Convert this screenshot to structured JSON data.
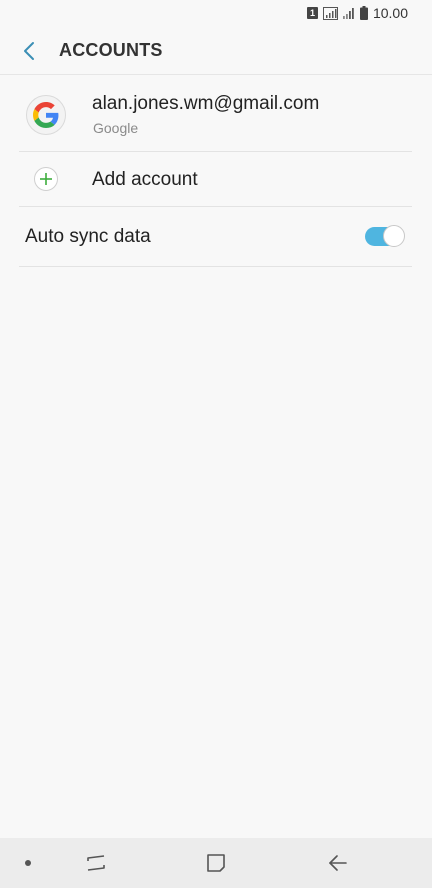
{
  "status_bar": {
    "sim_label": "1",
    "time": "10.00"
  },
  "header": {
    "title": "ACCOUNTS",
    "back_icon": "chevron-left-icon"
  },
  "accounts": [
    {
      "email": "alan.jones.wm@gmail.com",
      "provider": "Google",
      "icon": "google-logo-icon"
    }
  ],
  "add_account": {
    "label": "Add account",
    "icon": "plus-icon"
  },
  "auto_sync": {
    "label": "Auto sync data",
    "enabled": true
  },
  "nav_bar": {
    "items": [
      "dot-icon",
      "recent-apps-icon",
      "home-icon",
      "back-icon"
    ]
  },
  "colors": {
    "accent": "#4fb5e0",
    "add_icon_green": "#3dae3d",
    "back_arrow": "#3b8fb5"
  }
}
